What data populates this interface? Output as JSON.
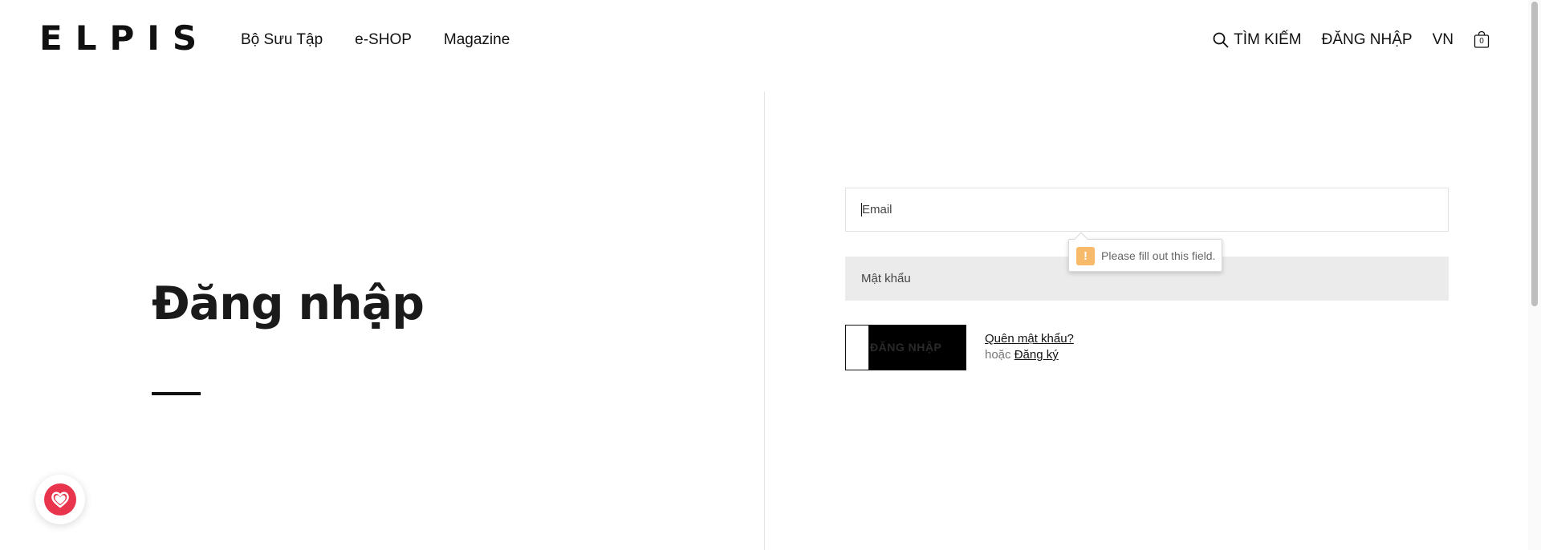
{
  "header": {
    "logo": "ELPIS",
    "nav": [
      {
        "label": "Bộ Sưu Tập"
      },
      {
        "label": "e-SHOP"
      },
      {
        "label": "Magazine"
      }
    ],
    "search_label": "TÌM KIẾM",
    "login_label": "ĐĂNG NHẬP",
    "language": "VN",
    "cart_count": "0"
  },
  "main": {
    "title": "Đăng nhập"
  },
  "form": {
    "email_placeholder": "Email",
    "password_placeholder": "Mật khẩu",
    "validation_message": "Please fill out this field.",
    "submit_label": "ĐĂNG NHẬP",
    "forgot_label": "Quên mật khẩu?",
    "or_label": "hoặc",
    "register_label": "Đăng ký"
  },
  "colors": {
    "accent": "#111111",
    "favorite": "#e8344d",
    "warning": "#f7b96a"
  },
  "icons": [
    "search-icon",
    "bag-icon",
    "warning-icon",
    "heart-icon"
  ]
}
